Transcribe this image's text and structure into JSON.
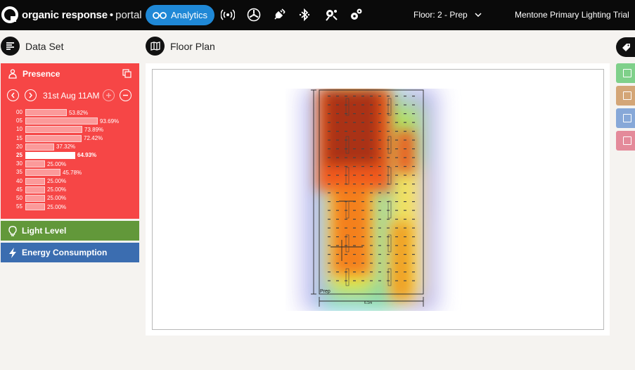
{
  "app": {
    "brand_bold": "organic response",
    "brand_sep": "•",
    "brand_light": "portal"
  },
  "topbar": {
    "analytics_label": "Analytics",
    "nav_icons": [
      "wireless-icon",
      "fan-icon",
      "plug-icon",
      "bluetooth-icon",
      "sensor-settings-icon",
      "settings-icon"
    ],
    "floor_label": "Floor: 2 - Prep",
    "site_label": "Mentone Primary Lighting Trial"
  },
  "dataset": {
    "heading": "Data Set",
    "presence": {
      "title": "Presence",
      "date": "31st Aug 11AM",
      "rows": [
        {
          "label": "00",
          "value": 53.82,
          "text": "53.82%"
        },
        {
          "label": "05",
          "value": 93.69,
          "text": "93.69%"
        },
        {
          "label": "10",
          "value": 73.89,
          "text": "73.89%"
        },
        {
          "label": "15",
          "value": 72.42,
          "text": "72.42%"
        },
        {
          "label": "20",
          "value": 37.32,
          "text": "37.32%"
        },
        {
          "label": "25",
          "value": 64.93,
          "text": "64.93%",
          "selected": true
        },
        {
          "label": "30",
          "value": 25.0,
          "text": "25.00%"
        },
        {
          "label": "35",
          "value": 45.78,
          "text": "45.78%"
        },
        {
          "label": "40",
          "value": 25.0,
          "text": "25.00%"
        },
        {
          "label": "45",
          "value": 25.0,
          "text": "25.00%"
        },
        {
          "label": "50",
          "value": 25.0,
          "text": "25.00%"
        },
        {
          "label": "55",
          "value": 25.0,
          "text": "25.00%"
        }
      ]
    },
    "light_level": "Light Level",
    "energy": "Energy Consumption"
  },
  "floorplan": {
    "heading": "Floor Plan",
    "room_label": "Prep",
    "dim_label": "6.1m"
  },
  "colors": {
    "topbar": "#0a0a0a",
    "accent": "#1f88d6",
    "presence": "#f64646",
    "light": "#62983a",
    "energy": "#3b6db0",
    "swatches": [
      "#7fd08a",
      "#d4a677",
      "#87a8d8",
      "#e48a9a"
    ]
  }
}
